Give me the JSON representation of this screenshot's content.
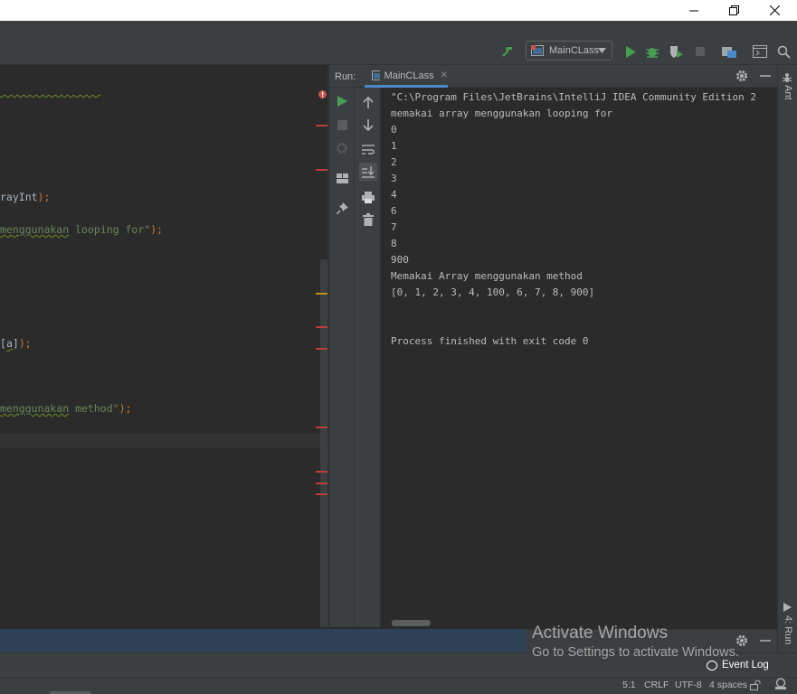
{
  "window": {
    "minimize": "minimize",
    "maximize": "restore",
    "close": "close"
  },
  "toolbar": {
    "run_config": "MainCLass"
  },
  "editor": {
    "lines": [
      {
        "text": "rayInt",
        "suffix": ");"
      },
      {
        "squig": "menggunakan",
        "str": " looping for\"",
        "suffix": ");"
      },
      {
        "pre": "[",
        "text": "a",
        "post": "]",
        "suffix": ");"
      },
      {
        "squig": "menggunakan",
        "str": " method\"",
        "suffix": ");"
      }
    ]
  },
  "run_panel": {
    "label": "Run:",
    "tab_title": "MainCLass",
    "console": [
      "\"C:\\Program Files\\JetBrains\\IntelliJ IDEA Community Edition 2",
      "memakai array menggunakan looping for",
      "0",
      "1",
      "2",
      "3",
      "4",
      "6",
      "7",
      "8",
      "900",
      "Memakai Array menggunakan method",
      "[0, 1, 2, 3, 4, 100, 6, 7, 8, 900]",
      "",
      "",
      "Process finished with exit code 0"
    ]
  },
  "right_stripe": {
    "ant": "Ant",
    "run": "4: Run"
  },
  "event_log": "Event Log",
  "activate_windows": {
    "title": "Activate Windows",
    "subtitle": "Go to Settings to activate Windows."
  },
  "status": {
    "position": "5:1",
    "line_sep": "CRLF",
    "encoding": "UTF-8",
    "indent": "4 spaces"
  },
  "colors": {
    "accent": "#4a88c7",
    "run_green": "#499c54",
    "error_red": "#bc3f3c",
    "string_green": "#6a8759"
  }
}
